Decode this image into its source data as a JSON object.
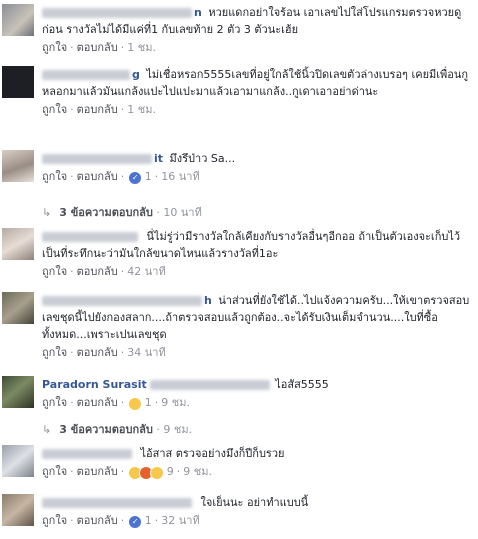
{
  "labels": {
    "like": "ถูกใจ",
    "reply": "ตอบกลับ"
  },
  "comments": [
    {
      "name_tail": "n",
      "text": "หวยแดกอย่าใจร้อน เอาเลขไปใส่โปรแกรมตรวจหวยดูก่อน รางวัลไม่ได้มีแค่ที่1 กับเลขท้าย 2 ตัว 3 ตัวนะเฮ้ย",
      "time": "1 ชม."
    },
    {
      "name_tail": "g",
      "text": "ไม่เชื่อหรอก5555เลขที่อยู่ใกล้ใช้นิ้วปิดเลขตัวล่างเบรอๆ เคยมีเพื่อนกูหลอกมาแล้วมันแกล้งแปะไปแปะมาแล้วเอามาแกล้ง..กูเดาเอาอย่าด่านะ",
      "time": "1 ชม."
    },
    {
      "name_tail": "it",
      "text": "มึงรึป่าว Sa...",
      "reaction_count": "1",
      "time": "16 นาที"
    },
    {
      "name_tail": "",
      "text": "นี่ไม่รู่ว่ามีรางวัลใกล้เคียงกับรางวัลอื่นๆอีกออ ถ้าเป็นตัวเองจะเก็บไว้เป็นที่ระทึกนะว่ามันใกล้ขนาดไหนแล้วรางวัลที่1อะ",
      "time": "42 นาที"
    },
    {
      "name_tail": "h",
      "text": "น่าส่วนที่ยังใช้ได้..ไปแจ้งความครับ...ให้เขาตรวจสอบเลขชุดนี้ไปยังกองสลาก....ถ้าตรวจสอบแล้วถูกต้อง..จะได้รับเงินเต็มจำนวน....ใบที่ซื้อทั้งหมด...เพราะเปนเลขชุด",
      "time": "34 นาที"
    },
    {
      "name_tail": "Paradorn Surasit",
      "text": "ไอสัส5555",
      "reaction_count": "1",
      "time": "9 ชม."
    },
    {
      "name_tail": "",
      "text": "ไอ้สาส ตรวจอย่างมึงก็ปีก็บรวย",
      "reaction_count": "9",
      "time": "9 ชม."
    },
    {
      "name_tail": "",
      "text": "ใจเย็นนะ อย่าทำแบบนี้",
      "reaction_count": "1",
      "time": "32 นาที"
    }
  ],
  "replies": [
    {
      "count": "3 ข้อความตอบกลับ",
      "time": "10 นาที"
    },
    {
      "count": "3 ข้อความตอบกลับ",
      "time": "9 ชม."
    }
  ]
}
